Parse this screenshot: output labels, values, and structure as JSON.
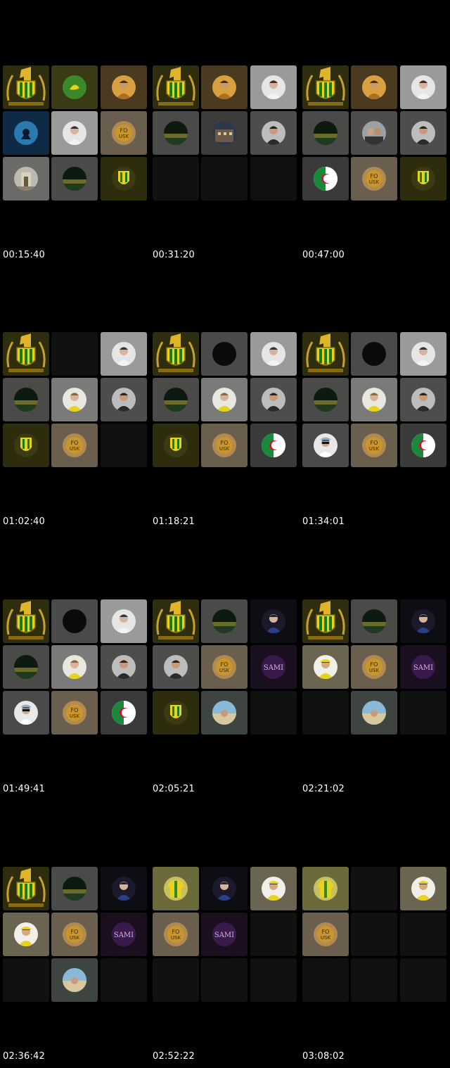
{
  "title": "Video call participant grid snapshots",
  "colors": {
    "background": "#000000",
    "timestamp_text": "#ffffff"
  },
  "tile_kinds": {
    "badge": "gold-green club crest tile (large '1' emblem)",
    "empty": "dark empty tile",
    "stadium": "stadium avatar",
    "man_grey": "man portrait avatar",
    "man_white": "man in white shirt avatar",
    "man_blue": "man in blue shirt avatar",
    "cap_man": "man with cap and sunglasses avatar",
    "selfie": "two men selfie avatar",
    "fo_usk": "FO USK gold badge avatar",
    "jsk_yellow": "yellow-green JSK crest avatar",
    "jersey": "yellow jersey avatar",
    "yellow_cap": "man in yellow cap avatar",
    "algeria": "Algeria flag avatar",
    "sami": "SAMI purple text avatar",
    "beach": "beach person avatar",
    "diver": "diver underwater avatar",
    "dark_circle": "dark circle avatar",
    "green_bird": "green-yellow bird avatar",
    "gold_man": "man on gold background avatar",
    "kiosk": "monument photo avatar",
    "building": "building photo avatar",
    "girl_yellow": "person in yellow avatar"
  },
  "frames": [
    {
      "timestamp": "00:15:40",
      "tiles": [
        "badge",
        "green_bird",
        "gold_man",
        "diver",
        "man_white",
        "fo_usk",
        "kiosk",
        "stadium",
        "jsk_yellow"
      ]
    },
    {
      "timestamp": "00:31:20",
      "tiles": [
        "badge",
        "gold_man",
        "man_white",
        "stadium",
        "building",
        "man_grey",
        "empty",
        "empty",
        "empty"
      ]
    },
    {
      "timestamp": "00:47:00",
      "tiles": [
        "badge",
        "gold_man",
        "man_white",
        "stadium",
        "selfie",
        "man_grey",
        "algeria",
        "fo_usk",
        "jsk_yellow"
      ]
    },
    {
      "timestamp": "01:02:40",
      "tiles": [
        "badge",
        "empty",
        "man_white",
        "stadium",
        "girl_yellow",
        "man_grey",
        "jsk_yellow",
        "fo_usk",
        "empty"
      ]
    },
    {
      "timestamp": "01:18:21",
      "tiles": [
        "badge",
        "dark_circle",
        "man_white",
        "stadium",
        "girl_yellow",
        "man_grey",
        "jsk_yellow",
        "fo_usk",
        "algeria"
      ]
    },
    {
      "timestamp": "01:34:01",
      "tiles": [
        "badge",
        "dark_circle",
        "man_white",
        "stadium",
        "girl_yellow",
        "man_grey",
        "cap_man",
        "fo_usk",
        "algeria"
      ]
    },
    {
      "timestamp": "01:49:41",
      "tiles": [
        "badge",
        "dark_circle",
        "man_white",
        "stadium",
        "girl_yellow",
        "man_grey",
        "cap_man",
        "fo_usk",
        "algeria"
      ]
    },
    {
      "timestamp": "02:05:21",
      "tiles": [
        "badge",
        "stadium",
        "man_blue",
        "man_grey",
        "fo_usk",
        "sami",
        "jsk_yellow",
        "beach",
        "empty"
      ]
    },
    {
      "timestamp": "02:21:02",
      "tiles": [
        "badge",
        "stadium",
        "man_blue",
        "yellow_cap",
        "fo_usk",
        "sami",
        "empty",
        "beach",
        "empty"
      ]
    },
    {
      "timestamp": "02:36:42",
      "tiles": [
        "badge",
        "stadium",
        "man_blue",
        "yellow_cap",
        "fo_usk",
        "sami",
        "empty",
        "beach",
        "empty"
      ]
    },
    {
      "timestamp": "02:52:22",
      "tiles": [
        "jersey",
        "man_blue",
        "yellow_cap",
        "fo_usk",
        "sami",
        "empty",
        "empty",
        "empty",
        "empty"
      ]
    },
    {
      "timestamp": "03:08:02",
      "tiles": [
        "jersey",
        "empty",
        "yellow_cap",
        "fo_usk",
        "empty",
        "empty",
        "empty",
        "empty",
        "empty"
      ]
    }
  ]
}
